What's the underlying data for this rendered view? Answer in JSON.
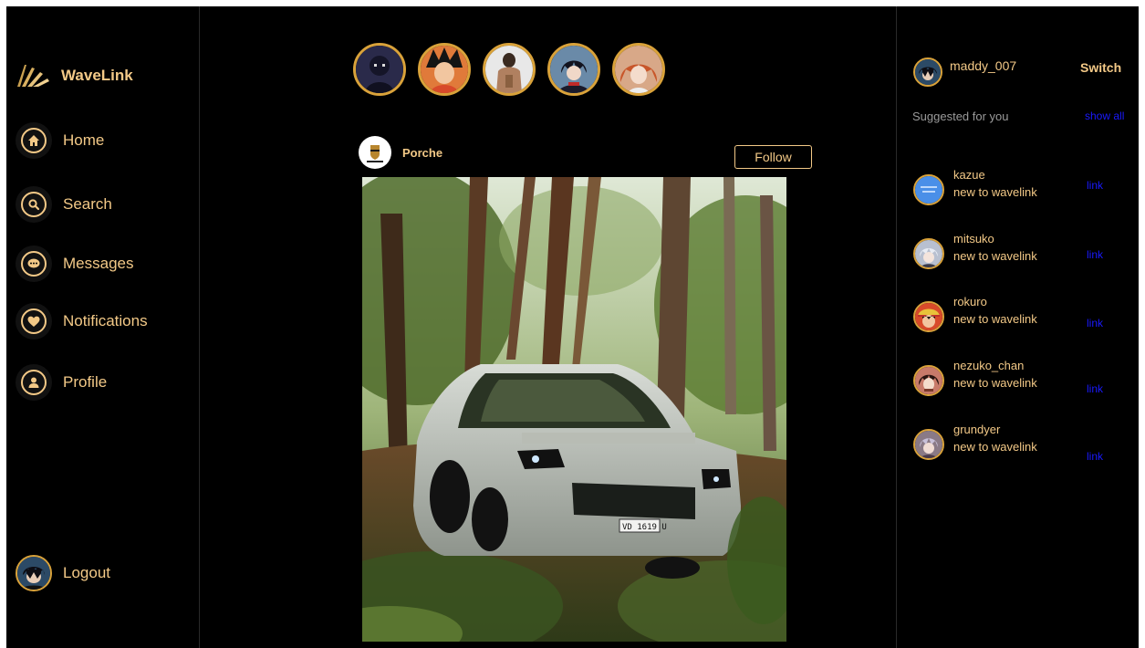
{
  "app": {
    "name": "WaveLink"
  },
  "nav": {
    "items": [
      {
        "label": "Home",
        "icon": "home-icon"
      },
      {
        "label": "Search",
        "icon": "search-icon"
      },
      {
        "label": "Messages",
        "icon": "chat-icon"
      },
      {
        "label": "Notifications",
        "icon": "heart-icon"
      },
      {
        "label": "Profile",
        "icon": "user-icon"
      }
    ],
    "logout_label": "Logout"
  },
  "stories": {
    "count": 5
  },
  "post": {
    "author": "Porche",
    "follow_label": "Follow",
    "plate_text": "VD 1619 U"
  },
  "rail": {
    "username": "maddy_007",
    "switch_label": "Switch",
    "suggested_title": "Suggested for you",
    "show_all_label": "show all",
    "suggestions": [
      {
        "name": "kazue",
        "subtitle": "new to wavelink",
        "link_label": "link"
      },
      {
        "name": "mitsuko",
        "subtitle": "new to wavelink",
        "link_label": "link"
      },
      {
        "name": "rokuro",
        "subtitle": "new to wavelink",
        "link_label": "link"
      },
      {
        "name": "nezuko_chan",
        "subtitle": "new to wavelink",
        "link_label": "link"
      },
      {
        "name": "grundyer",
        "subtitle": "new to wavelink",
        "link_label": "link"
      }
    ]
  },
  "colors": {
    "background": "#000000",
    "accent": "#f3c987",
    "ring": "#d9a23a",
    "link": "#1a1aff",
    "muted": "#9a9a9a"
  }
}
